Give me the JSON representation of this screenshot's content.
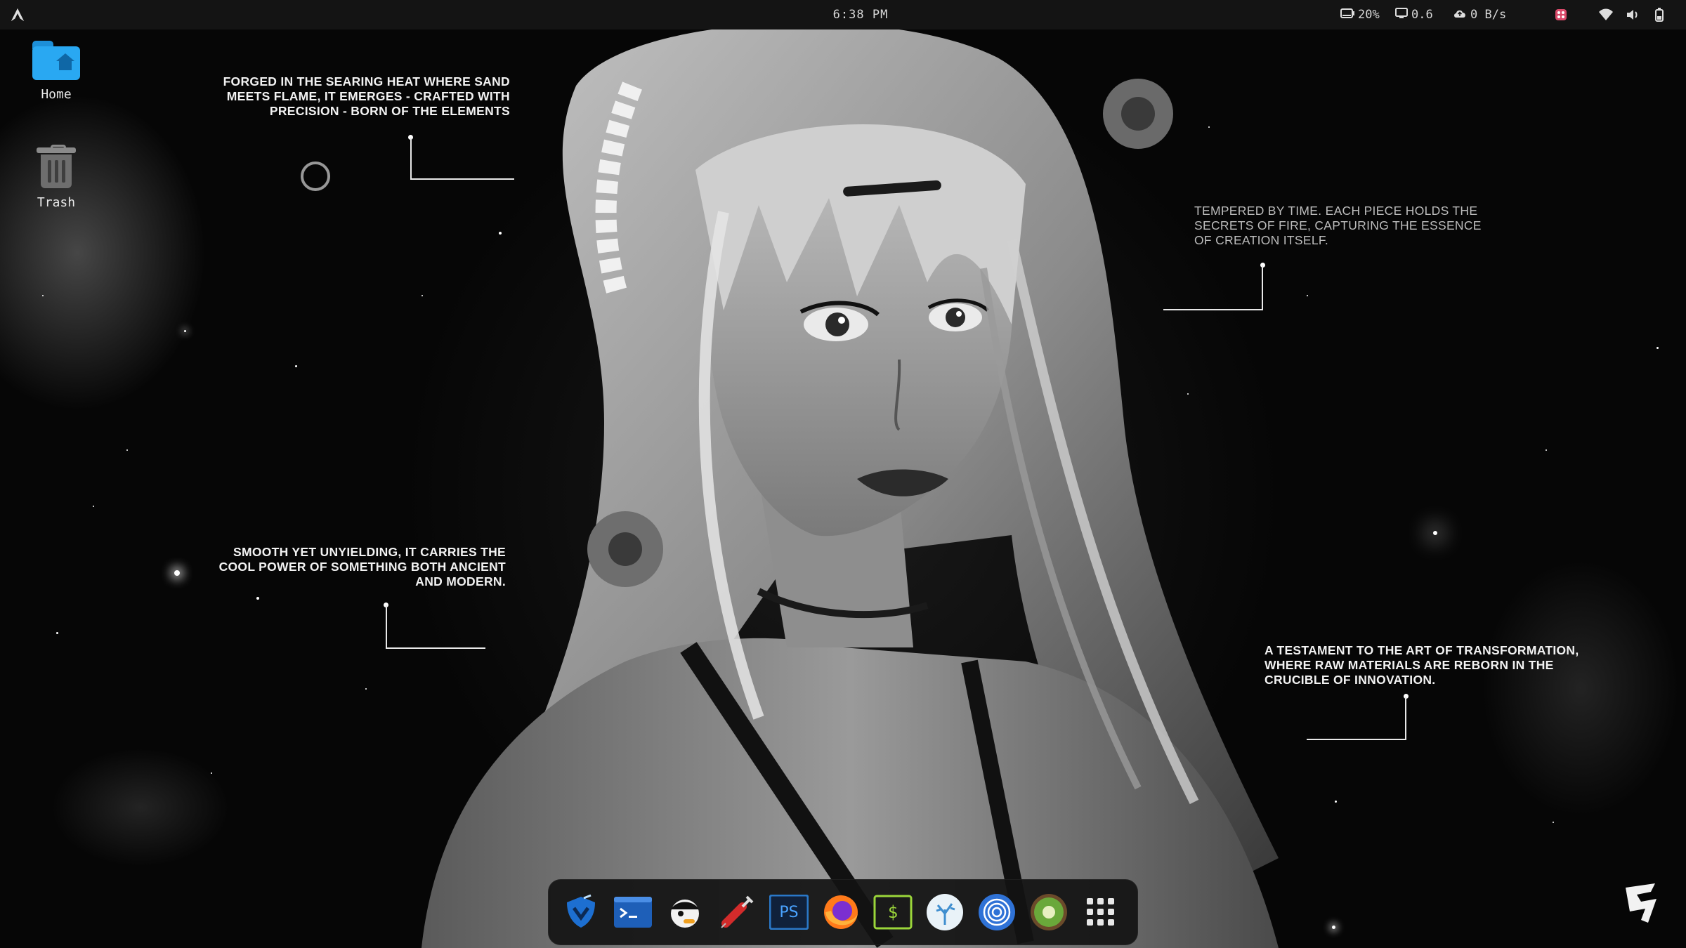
{
  "topbar": {
    "clock": "6:38 PM",
    "battery": "20%",
    "cpu": "0.6",
    "network": "0 B/s"
  },
  "desktop_icons": [
    {
      "label": "Home",
      "icon": "folder-home-icon"
    },
    {
      "label": "Trash",
      "icon": "trash-icon"
    }
  ],
  "annotations": [
    {
      "text": "FORGED IN THE SEARING HEAT WHERE SAND MEETS FLAME, IT EMERGES - CRAFTED WITH PRECISION - BORN OF THE ELEMENTS"
    },
    {
      "text": "TEMPERED BY TIME. EACH PIECE HOLDS THE SECRETS OF FIRE, CAPTURING THE ESSENCE OF CREATION ITSELF."
    },
    {
      "text": "SMOOTH YET UNYIELDING, IT CARRIES THE COOL POWER OF SOMETHING BOTH ANCIENT AND MODERN."
    },
    {
      "text": "A TESTAMENT TO THE ART OF TRANSFORMATION, WHERE RAW MATERIALS ARE REBORN IN THE CRUCIBLE OF INNOVATION."
    }
  ],
  "dock_items": [
    {
      "id": "shield-app",
      "icon": "shield-app-icon",
      "color": "#1d6fd1"
    },
    {
      "id": "terminal",
      "icon": "terminal-icon",
      "color": "#1e5fb8"
    },
    {
      "id": "pirate-app",
      "icon": "pirate-icon",
      "color": "#f2f2f2"
    },
    {
      "id": "syringe-app",
      "icon": "syringe-icon",
      "color": "#d32b2b"
    },
    {
      "id": "powershell",
      "icon": "powershell-icon",
      "label": "PS",
      "color": "#2a78c8"
    },
    {
      "id": "firefox",
      "icon": "firefox-icon",
      "color": "#ff7a1a"
    },
    {
      "id": "shell",
      "icon": "shell-prompt-icon",
      "label": "$",
      "color": "#9bd63a"
    },
    {
      "id": "coral-app",
      "icon": "coral-icon",
      "color": "#e9f2f8"
    },
    {
      "id": "fingerprint-app",
      "icon": "fingerprint-icon",
      "color": "#2f72d6"
    },
    {
      "id": "kiwi-app",
      "icon": "kiwi-icon",
      "color": "#6aa83a"
    },
    {
      "id": "app-grid",
      "icon": "app-grid-icon",
      "color": "#e8e8e8"
    }
  ],
  "colors": {
    "background": "#050505",
    "topbar": "#141414",
    "accent_folder": "#29a8f2"
  }
}
